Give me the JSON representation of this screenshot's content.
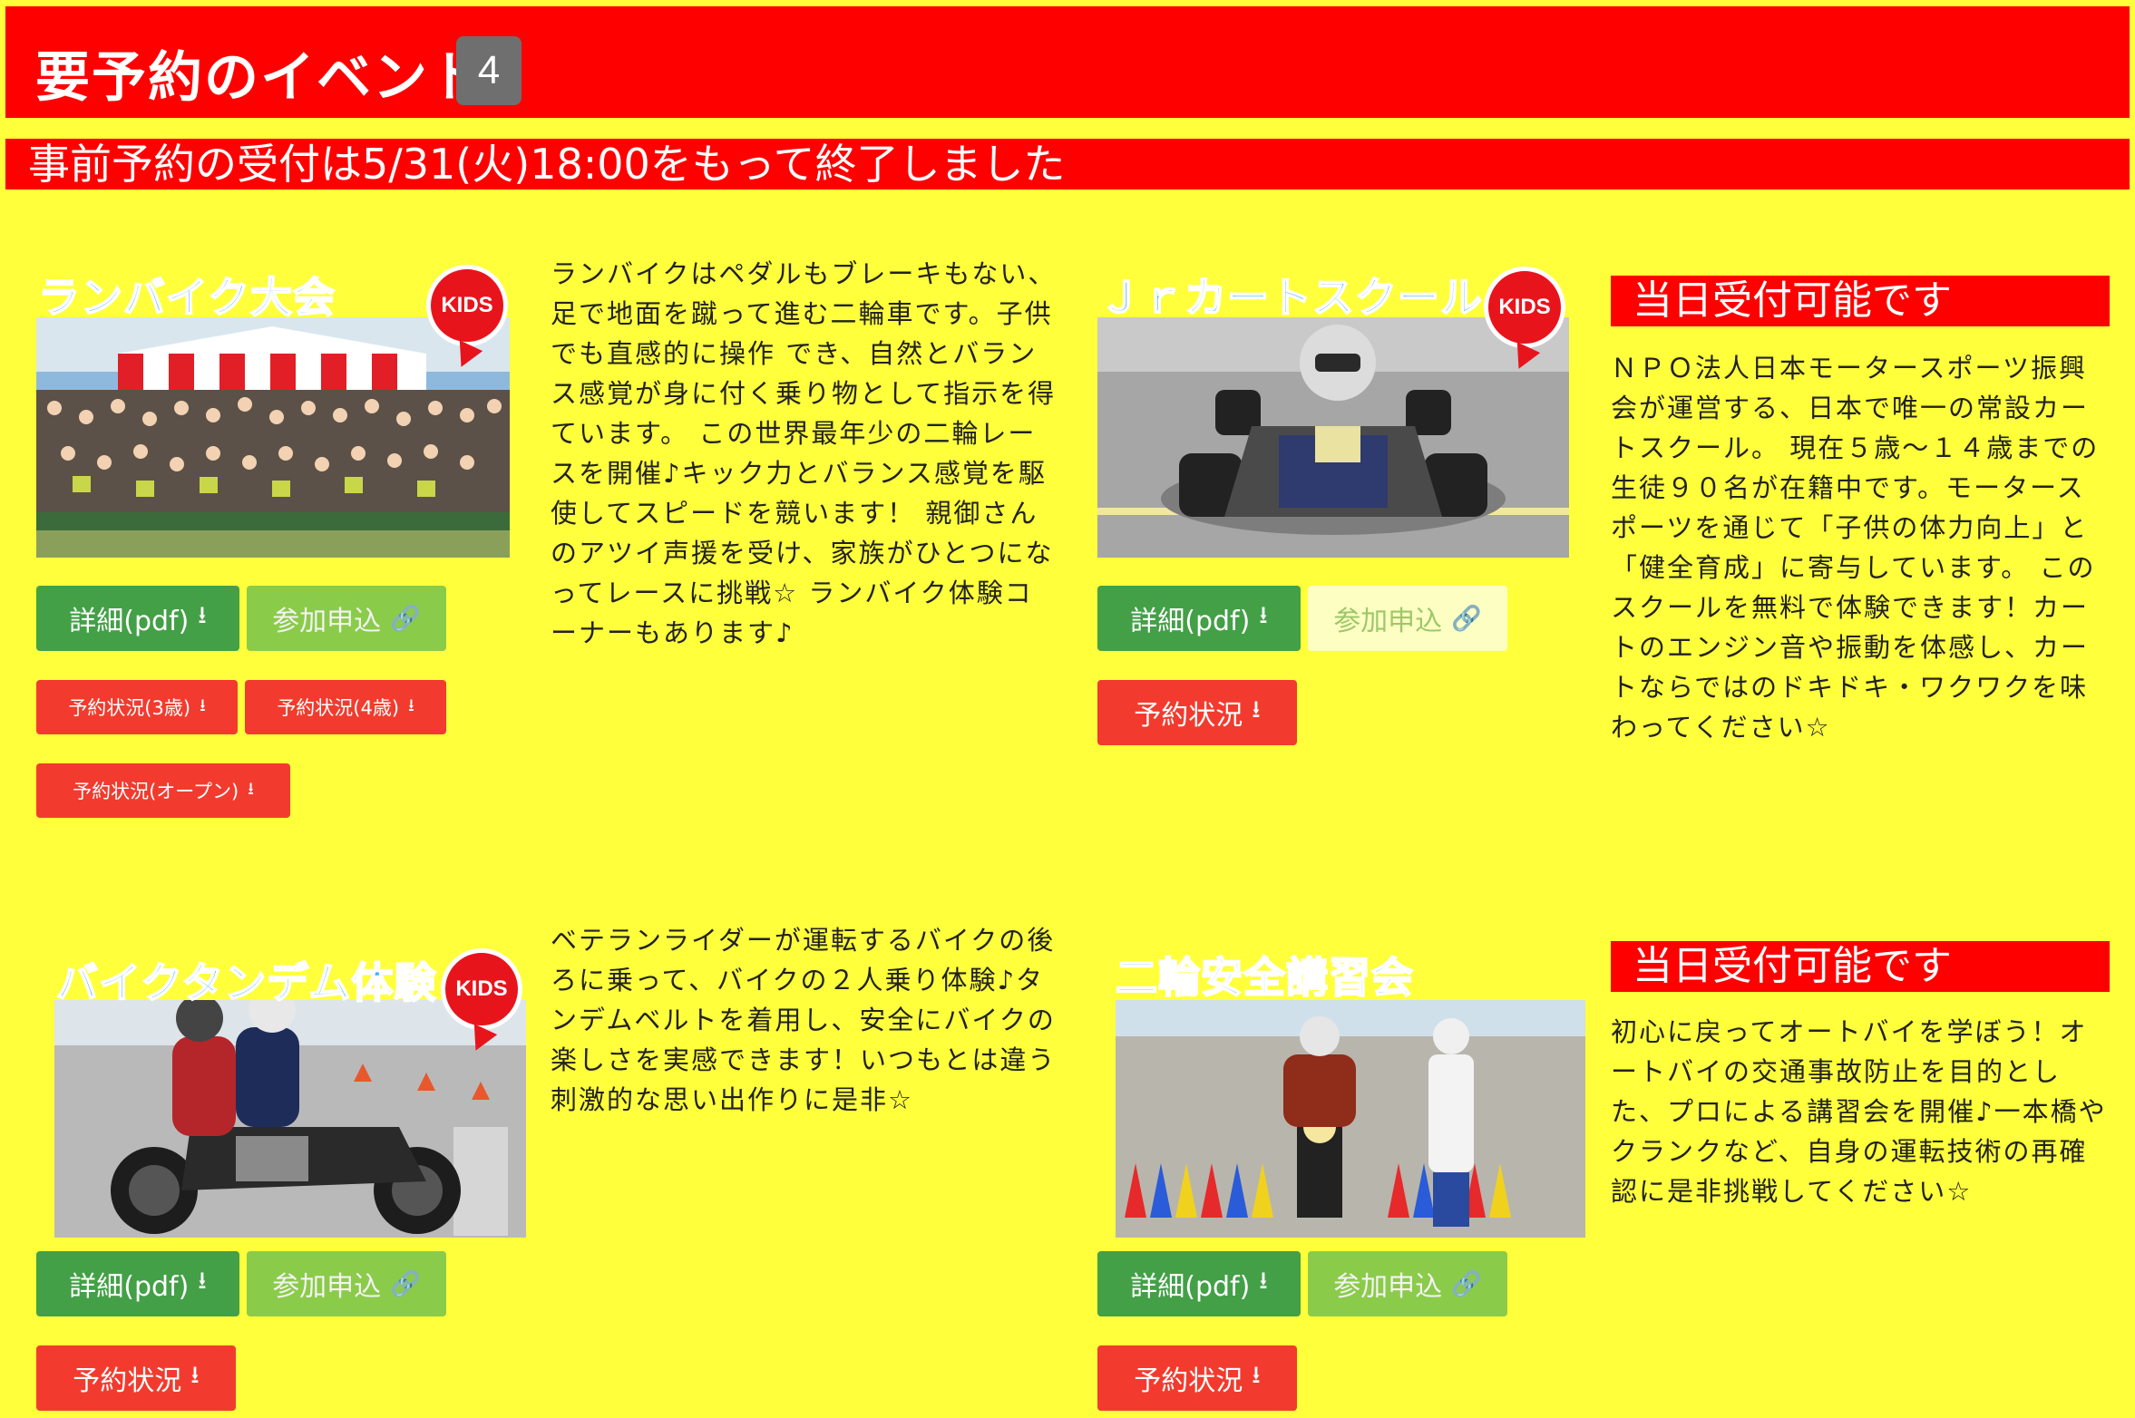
{
  "header": {
    "title": "要予約のイベント",
    "count": "4"
  },
  "notice": "事前予約の受付は5/31(火)18:00をもって終了しました",
  "badge_text": "KIDS",
  "colors": {
    "page_bg": "#ffff3c",
    "banner": "#ff0000",
    "detail_green": "#43a047",
    "apply_green": "#8bcb4a",
    "status_red": "#f23b2e",
    "title_blue": "#3fb4f4"
  },
  "icons": {
    "download": "download-icon",
    "link": "link-icon"
  },
  "events": [
    {
      "image_title": "ランバイク大会",
      "detail_label": "詳細(pdf)",
      "apply_label": "参加申込",
      "status_buttons": [
        "予約状況(3歳)",
        "予約状況(4歳)",
        "予約状況(オープン)"
      ],
      "description": "ランバイクはペダルもブレーキもない、足で地面を蹴って進む二輪車です。子供でも直感的に操作 でき、自然とバランス感覚が身に付く乗り物として指示を得ています。 この世界最年少の二輪レースを開催♪キック力とバランス感覚を駆使してスピードを競います！ 親御さんのアツイ声援を受け、家族がひとつになってレースに挑戦☆ ランバイク体験コーナーもあります♪"
    },
    {
      "image_title": "Ｊｒカートスクール",
      "detail_label": "詳細(pdf)",
      "apply_label": "参加申込",
      "status_label": "予約状況",
      "same_day": "当日受付可能です",
      "description": "ＮＰＯ法人日本モータースポーツ振興会が運営する、日本で唯一の常設カートスクール。 現在５歳〜１４歳までの生徒９０名が在籍中です。モータースポーツを通じて「子供の体力向上」と「健全育成」に寄与しています。 このスクールを無料で体験できます！カートのエンジン音や振動を体感し、カートならではのドキドキ・ワクワクを味わってください☆"
    },
    {
      "image_title": "バイクタンデム体験",
      "detail_label": "詳細(pdf)",
      "apply_label": "参加申込",
      "status_label": "予約状況",
      "description": "ベテランライダーが運転するバイクの後ろに乗って、バイクの２人乗り体験♪タンデムベルトを着用し、安全にバイクの楽しさを実感できます！いつもとは違う刺激的な思い出作りに是非☆"
    },
    {
      "image_title": "二輪安全講習会",
      "detail_label": "詳細(pdf)",
      "apply_label": "参加申込",
      "status_label": "予約状況",
      "same_day": "当日受付可能です",
      "description": "初心に戻ってオートバイを学ぼう！オートバイの交通事故防止を目的とした、プロによる講習会を開催♪一本橋やクランクなど、自身の運転技術の再確認に是非挑戦してください☆"
    }
  ]
}
